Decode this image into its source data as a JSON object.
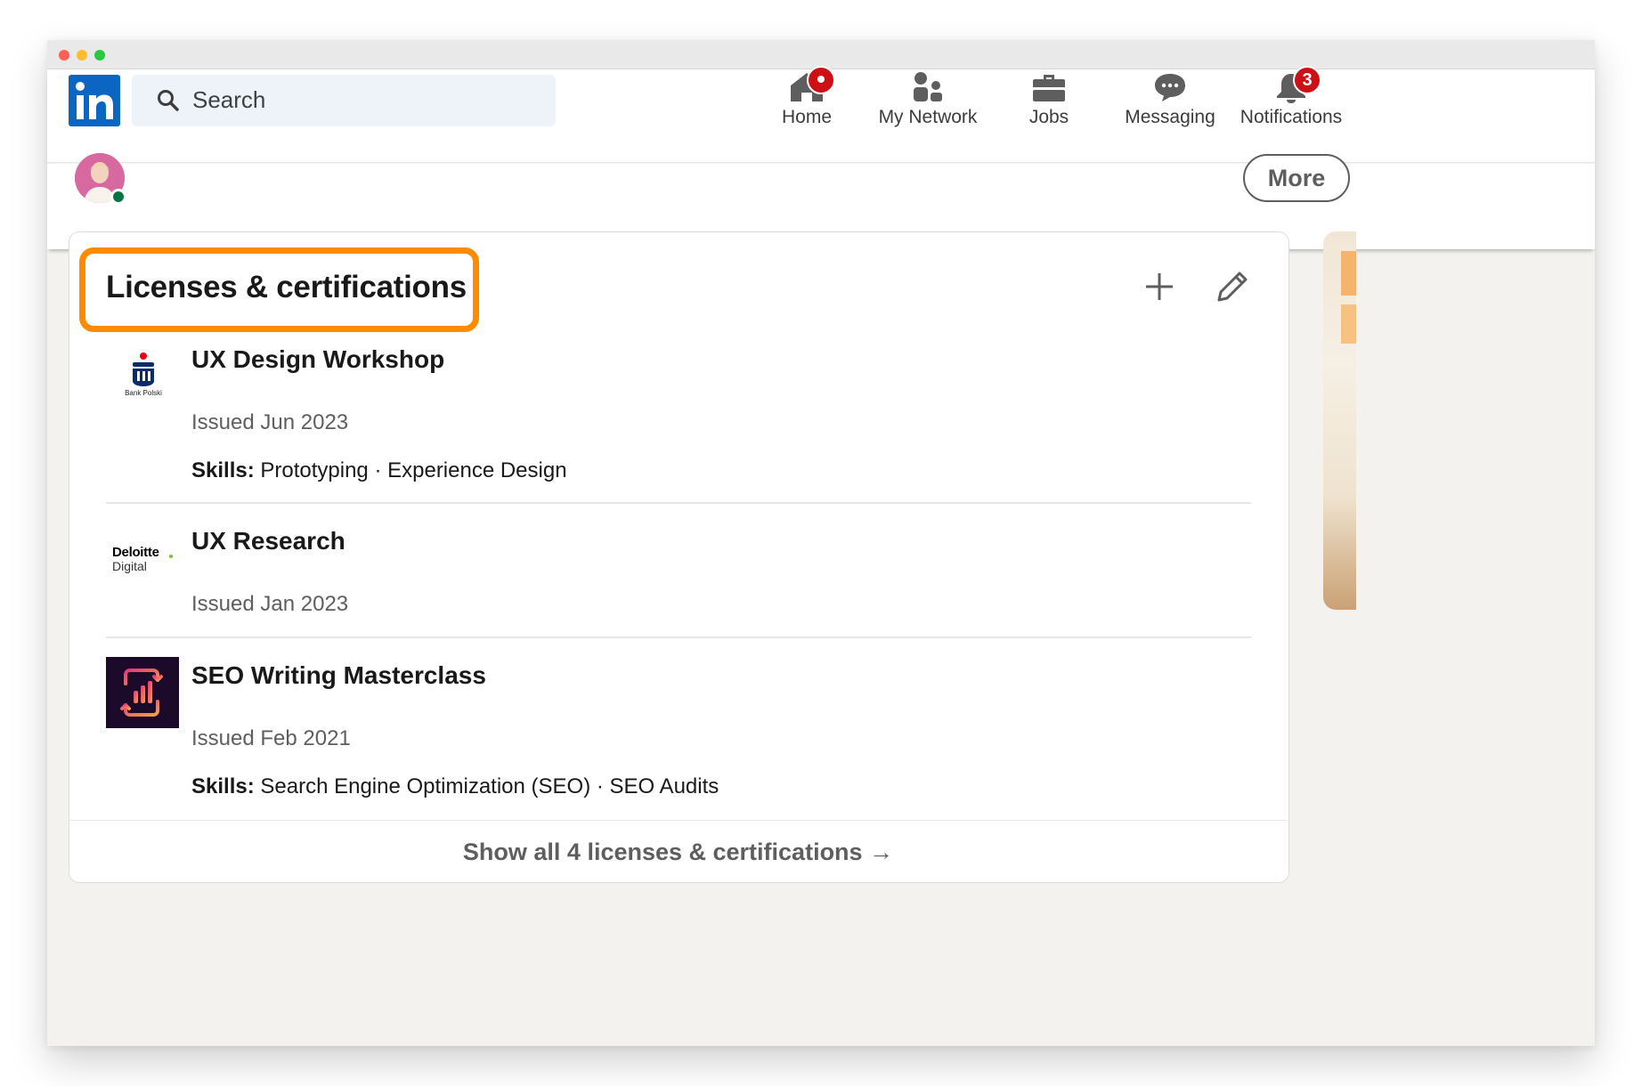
{
  "nav": {
    "search_placeholder": "Search",
    "items": [
      {
        "label": "Home",
        "icon": "home-icon",
        "badge": ""
      },
      {
        "label": "My Network",
        "icon": "network-icon",
        "badge": ""
      },
      {
        "label": "Jobs",
        "icon": "briefcase-icon",
        "badge": ""
      },
      {
        "label": "Messaging",
        "icon": "chat-icon",
        "badge": ""
      },
      {
        "label": "Notifications",
        "icon": "bell-icon",
        "badge": "3"
      }
    ]
  },
  "subbar": {
    "more_label": "More"
  },
  "section": {
    "title": "Licenses & certifications",
    "show_all": "Show all 4 licenses & certifications →"
  },
  "certifications": [
    {
      "title": "UX Design Workshop",
      "issued": "Issued Jun 2023",
      "skills_label": "Skills:",
      "skills": "Prototyping · Experience Design",
      "logo_text": "Bank Polski"
    },
    {
      "title": "UX Research",
      "issued": "Issued Jan 2023",
      "skills_label": "",
      "skills": "",
      "logo_text_1": "Deloitte",
      "logo_text_2": "Digital"
    },
    {
      "title": "SEO Writing Masterclass",
      "issued": "Issued Feb 2021",
      "skills_label": "Skills:",
      "skills": "Search Engine Optimization (SEO) · SEO Audits"
    }
  ],
  "colors": {
    "linkedin_blue": "#0a66c2",
    "highlight_orange": "#ff8c00",
    "badge_red": "#cc1016",
    "presence_green": "#057642"
  }
}
